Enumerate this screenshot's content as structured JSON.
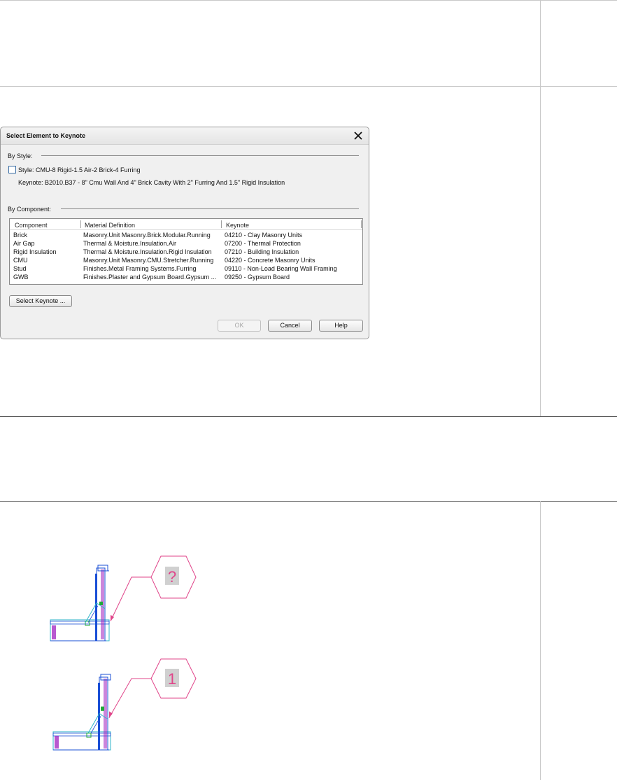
{
  "dialog": {
    "title": "Select Element to Keynote",
    "by_style_label": "By Style:",
    "style_checkbox_label": "Style: CMU-8 Rigid-1.5 Air-2 Brick-4 Furring",
    "style_keynote": "Keynote: B2010.B37 - 8\" Cmu Wall And 4\" Brick Cavity With 2\" Furring And 1.5\" Rigid Insulation",
    "by_component_label": "By Component:",
    "columns": [
      "Component",
      "Material Definition",
      "Keynote"
    ],
    "rows": [
      [
        "Brick",
        "Masonry.Unit Masonry.Brick.Modular.Running",
        "04210 - Clay Masonry Units"
      ],
      [
        "Air Gap",
        "Thermal & Moisture.Insulation.Air",
        "07200 - Thermal Protection"
      ],
      [
        "Rigid Insulation",
        "Thermal & Moisture.Insulation.Rigid Insulation",
        "07210 - Building Insulation"
      ],
      [
        "CMU",
        "Masonry.Unit Masonry.CMU.Stretcher.Running",
        "04220 - Concrete Masonry Units"
      ],
      [
        "Stud",
        "Finishes.Metal Framing Systems.Furring",
        "09110 - Non-Load Bearing Wall Framing"
      ],
      [
        "GWB",
        "Finishes.Plaster and Gypsum Board.Gypsum ...",
        "09250 - Gypsum Board"
      ]
    ],
    "select_keynote_button": "Select Keynote ...",
    "ok_button": "OK",
    "cancel_button": "Cancel",
    "help_button": "Help"
  },
  "drawings": {
    "tag_before": "?",
    "tag_after": "1"
  },
  "colors": {
    "tag_pink": "#e0458a",
    "wall_blue": "#1a4fd6",
    "insulation_purple": "#a020c0",
    "green_mark": "#1fa83a",
    "cyan": "#2fb5c8"
  }
}
